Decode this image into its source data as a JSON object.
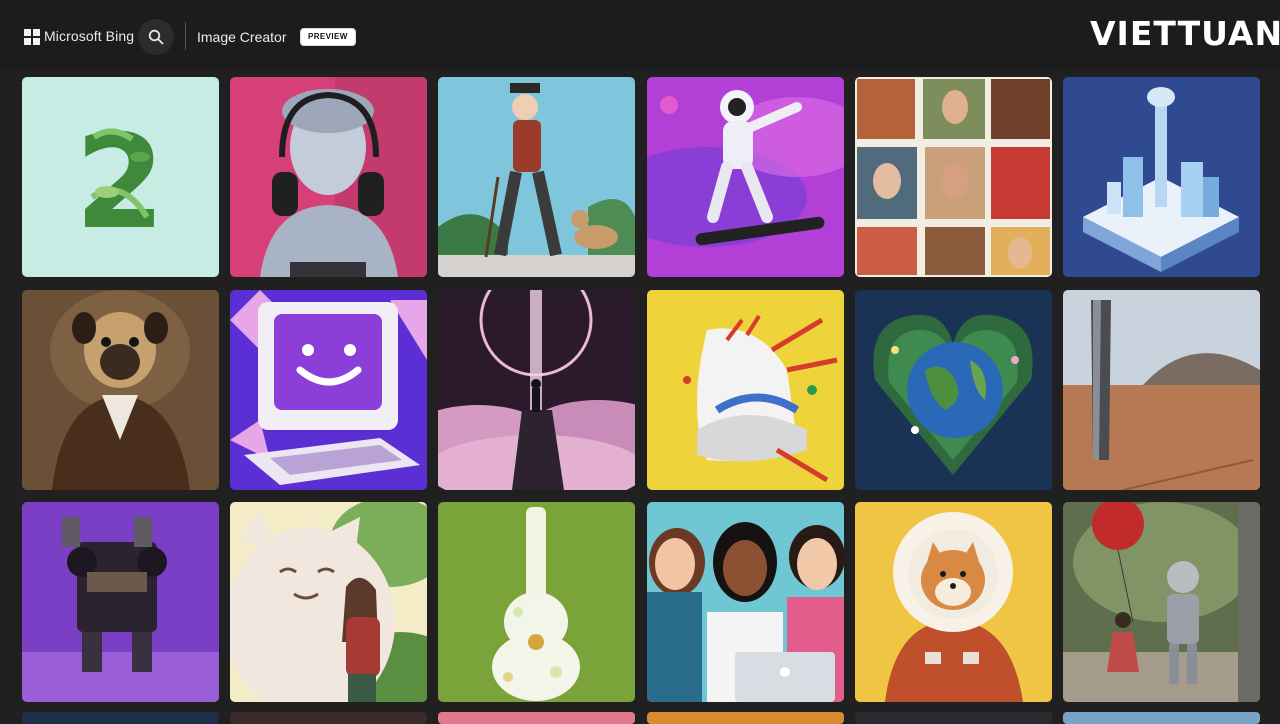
{
  "header": {
    "brand_label": "Microsoft Bing",
    "product_label": "Image Creator",
    "badge_label": "PREVIEW",
    "search_icon": "search-icon",
    "logo_icon": "microsoft-logo-icon"
  },
  "watermark": {
    "text": "VIETTUAN"
  },
  "tile_numeral": "2",
  "gallery": {
    "rows": 3,
    "columns": 6,
    "subjects": [
      "green-leaf-number-two",
      "marble-bust-with-headphones",
      "old-man-walking-dog",
      "astronaut-on-skateboard",
      "painted-portrait-collage",
      "isometric-city-tower",
      "pug-in-victorian-suit",
      "smiling-retro-computer",
      "figure-on-cloud-rock",
      "exploding-sneaker",
      "earth-in-flower-heart",
      "mirror-monolith-desert",
      "vintage-robot-on-purple",
      "giant-cat-with-girl",
      "flower-guitar",
      "three-women-with-laptop",
      "shiba-astronaut",
      "girl-robot-red-balloon"
    ]
  },
  "colors": {
    "page_background": "#202020",
    "header_background": "#1c1c1c",
    "badge_background": "#ffffff"
  }
}
